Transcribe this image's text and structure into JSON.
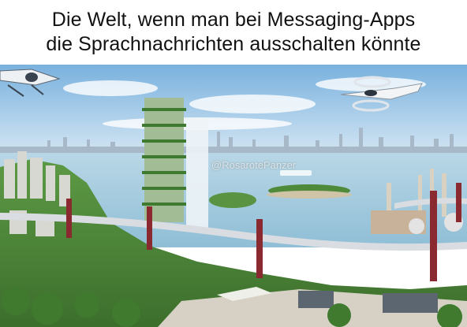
{
  "caption": {
    "line1": "Die Welt, wenn man bei Messaging-Apps",
    "line2": "die Sprachnachrichten ausschalten könnte"
  },
  "watermark": "@RosarotePanzer",
  "colors": {
    "sky_top": "#7fb6e0",
    "sky_bottom": "#dcebf5",
    "water": "#9cc6dc",
    "greenery": "#4f8a3a",
    "bridge_red": "#8a2a30",
    "bridge_deck": "#d9dde2"
  }
}
